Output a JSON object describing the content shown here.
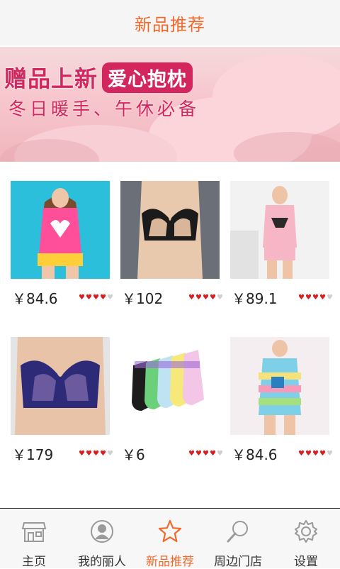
{
  "header": {
    "title": "新品推荐"
  },
  "banner": {
    "headline": "赠品上新",
    "tag": "爱心抱枕",
    "subline": "冬日暖手、午休必备",
    "slides": 3,
    "active_slide": 1
  },
  "products": [
    {
      "price": "￥84.6",
      "rating": 4,
      "image": "pink-tank-top-shorts-set",
      "colors": [
        "#2bbfdc",
        "#ff4f9a"
      ]
    },
    {
      "price": "￥102",
      "rating": 4,
      "image": "black-lace-bra",
      "colors": [
        "#6a6f78",
        "#1b1b1b"
      ]
    },
    {
      "price": "￥89.1",
      "rating": 4,
      "image": "pink-cat-pajama-set",
      "colors": [
        "#f2f2f2",
        "#f7b6c6"
      ]
    },
    {
      "price": "￥179",
      "rating": 4,
      "image": "navy-lace-bra",
      "colors": [
        "#e4e4e4",
        "#2d2a78"
      ]
    },
    {
      "price": "￥6",
      "rating": 4,
      "image": "colorful-socks-set",
      "colors": [
        "#ffffff",
        "#6ad07a"
      ]
    },
    {
      "price": "￥84.6",
      "rating": 4,
      "image": "striped-pajama-set",
      "colors": [
        "#f4eef0",
        "#7ecfe8"
      ]
    }
  ],
  "tabs": [
    {
      "label": "主页",
      "icon": "storefront-icon",
      "active": false
    },
    {
      "label": "我的丽人",
      "icon": "profile-icon",
      "active": false
    },
    {
      "label": "新品推荐",
      "icon": "star-icon",
      "active": true
    },
    {
      "label": "周边门店",
      "icon": "magnifier-icon",
      "active": false
    },
    {
      "label": "设置",
      "icon": "gear-icon",
      "active": false
    }
  ],
  "colors": {
    "accent": "#f06a2c",
    "star_red": "#d81e1e",
    "banner_text": "#d3265f"
  }
}
